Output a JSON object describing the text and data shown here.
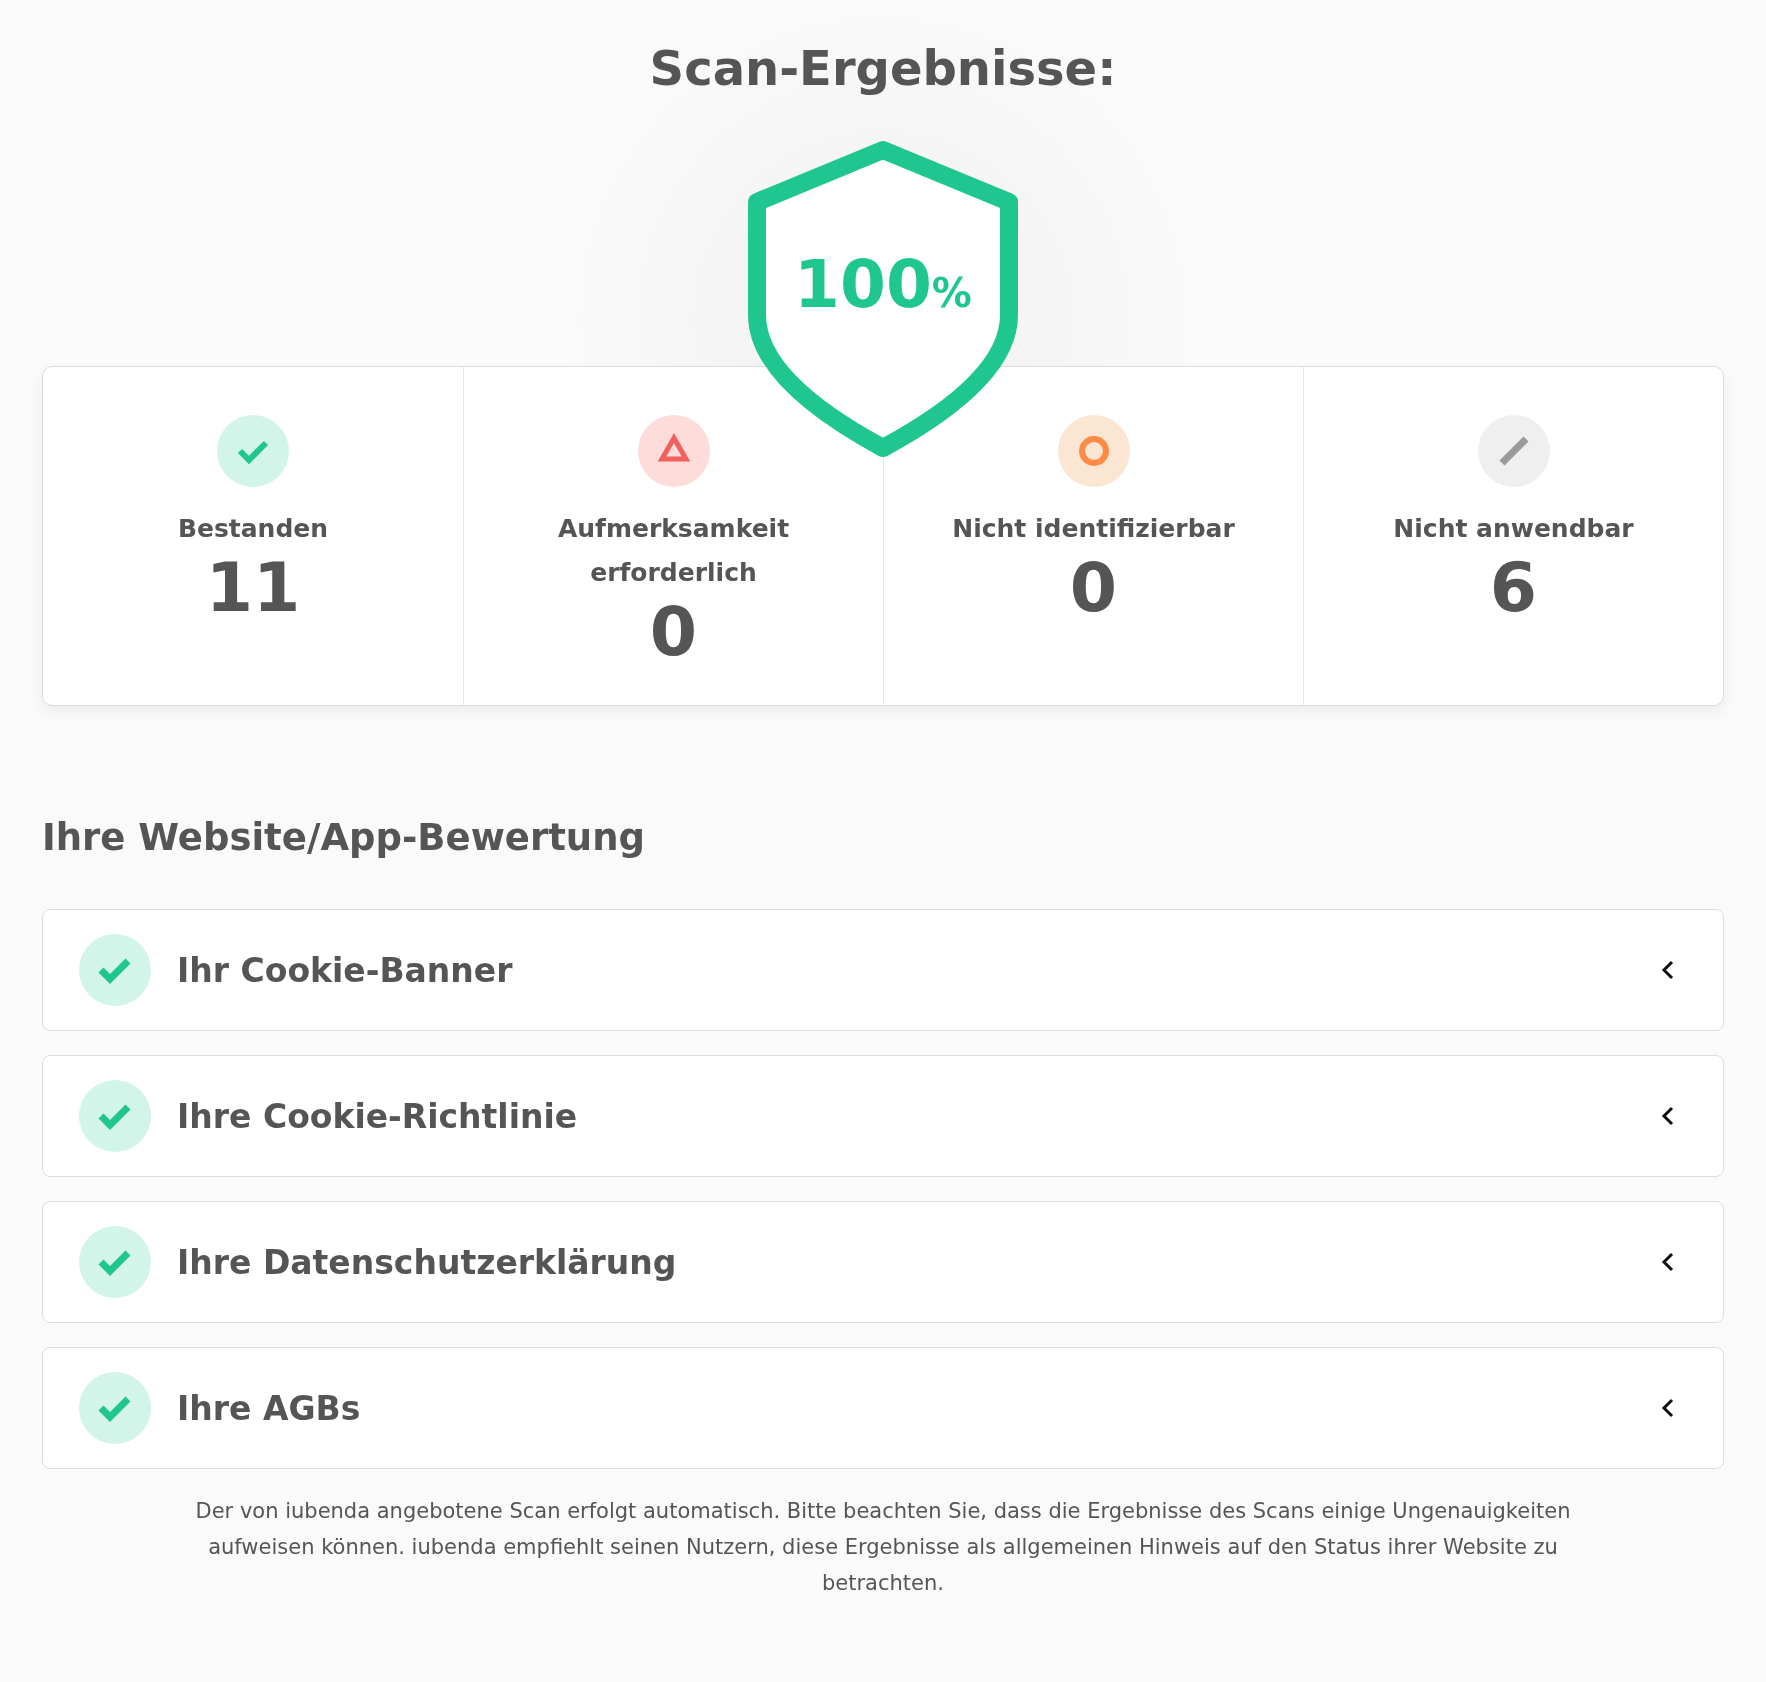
{
  "title": "Scan-Ergebnisse:",
  "score": {
    "value": "100",
    "unit": "%"
  },
  "stats": [
    {
      "kind": "passed",
      "label": "Bestanden",
      "count": "11"
    },
    {
      "kind": "attention",
      "label": "Aufmerksamkeit erforderlich",
      "count": "0"
    },
    {
      "kind": "unknown",
      "label": "Nicht identifizierbar",
      "count": "0"
    },
    {
      "kind": "na",
      "label": "Nicht anwendbar",
      "count": "6"
    }
  ],
  "section_title": "Ihre Website/App-Bewertung",
  "sections": [
    {
      "kind": "passed",
      "label": "Ihr Cookie-Banner"
    },
    {
      "kind": "passed",
      "label": "Ihre Cookie-Richtlinie"
    },
    {
      "kind": "passed",
      "label": "Ihre Datenschutzerklärung"
    },
    {
      "kind": "passed",
      "label": "Ihre AGBs"
    }
  ],
  "disclaimer": "Der von iubenda angebotene Scan erfolgt automatisch. Bitte beachten Sie, dass die Ergebnisse des Scans einige Ungenauigkeiten aufweisen können. iubenda empfiehlt seinen Nutzern, diese Ergebnisse als allgemeinen Hinweis auf den Status ihrer Website zu betrachten."
}
